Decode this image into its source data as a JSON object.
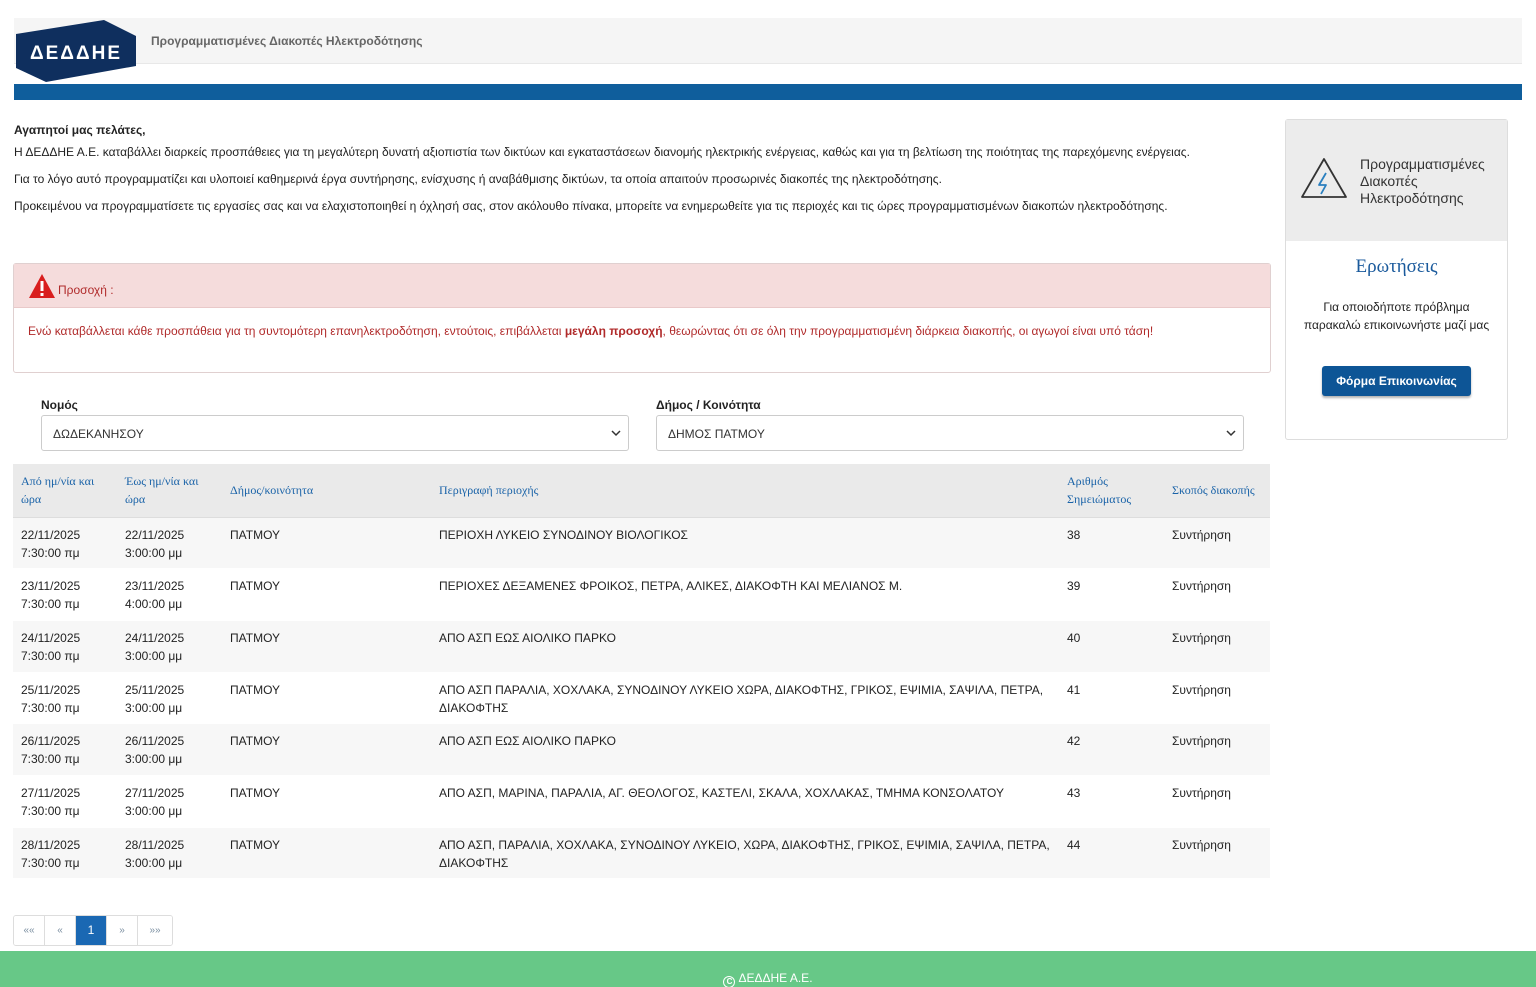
{
  "header": {
    "logo_text": "ΔΕΔΔΗΕ",
    "title": "Προγραμματισμένες Διακοπές Ηλεκτροδότησης"
  },
  "intro": {
    "greeting": "Αγαπητοί μας πελάτες,",
    "p1": "Η ΔΕΔΔΗΕ Α.Ε. καταβάλλει διαρκείς προσπάθειες για τη μεγαλύτερη δυνατή αξιοπιστία των δικτύων και εγκαταστάσεων διανομής ηλεκτρικής ενέργειας, καθώς και για τη βελτίωση της ποιότητας της παρεχόμενης ενέργειας.",
    "p2": "Για το λόγο αυτό προγραμματίζει και υλοποιεί καθημερινά έργα συντήρησης, ενίσχυσης ή αναβάθμισης δικτύων, τα οποία απαιτούν προσωρινές διακοπές της ηλεκτροδότησης.",
    "p3": "Προκειμένου να προγραμματίσετε τις εργασίες σας και να ελαχιστοποιηθεί η όχλησή σας, στον ακόλουθο πίνακα, μπορείτε να ενημερωθείτε για τις περιοχές και τις ώρες προγραμματισμένων διακοπών ηλεκτροδότησης."
  },
  "alert": {
    "title": "Προσοχή :",
    "text_before": "Ενώ καταβάλλεται κάθε προσπάθεια για τη συντομότερη επανηλεκτροδότηση, εντούτοις, επιβάλλεται ",
    "text_bold": "μεγάλη προσοχή",
    "text_after": ", θεωρώντας ότι σε όλη την προγραμματισμένη διάρκεια διακοπής, οι αγωγοί είναι υπό τάση!"
  },
  "filters": {
    "prefecture_label": "Νομός",
    "prefecture_value": "ΔΩΔΕΚΑΝΗΣΟΥ",
    "municipality_label": "Δήμος / Κοινότητα",
    "municipality_value": "ΔΗΜΟΣ ΠΑΤΜΟΥ"
  },
  "table": {
    "headers": {
      "from": "Από ημ/νία και ώρα",
      "to": "Έως ημ/νία και ώρα",
      "municipality": "Δήμος/κοινότητα",
      "area": "Περιγραφή περιοχής",
      "note_number": "Αριθμός Σημειώματος",
      "purpose": "Σκοπός διακοπής"
    },
    "rows": [
      {
        "from_date": "22/11/2025",
        "from_time": "7:30:00 πμ",
        "to_date": "22/11/2025",
        "to_time": "3:00:00 μμ",
        "municipality": "ΠΑΤΜΟΥ",
        "area": "ΠΕΡΙΟΧΗ ΛΥΚΕΙΟ ΣΥΝΟΔΙΝΟΥ ΒΙΟΛΟΓΙΚΟΣ",
        "note": "38",
        "purpose": "Συντήρηση"
      },
      {
        "from_date": "23/11/2025",
        "from_time": "7:30:00 πμ",
        "to_date": "23/11/2025",
        "to_time": "4:00:00 μμ",
        "municipality": "ΠΑΤΜΟΥ",
        "area": "ΠΕΡΙΟΧΕΣ ΔΕΞΑΜΕΝΕΣ ΦΡΟΙΚΟΣ, ΠΕΤΡΑ, ΑΛΙΚΕΣ, ΔΙΑΚΟΦΤΗ ΚΑΙ ΜΕΛΙΑΝΟΣ Μ.",
        "note": "39",
        "purpose": "Συντήρηση"
      },
      {
        "from_date": "24/11/2025",
        "from_time": "7:30:00 πμ",
        "to_date": "24/11/2025",
        "to_time": "3:00:00 μμ",
        "municipality": "ΠΑΤΜΟΥ",
        "area": "ΑΠΟ ΑΣΠ ΕΩΣ ΑΙΟΛΙΚΟ ΠΑΡΚΟ",
        "note": "40",
        "purpose": "Συντήρηση"
      },
      {
        "from_date": "25/11/2025",
        "from_time": "7:30:00 πμ",
        "to_date": "25/11/2025",
        "to_time": "3:00:00 μμ",
        "municipality": "ΠΑΤΜΟΥ",
        "area": "ΑΠΟ ΑΣΠ ΠΑΡΑΛΙΑ, ΧΟΧΛΑΚΑ, ΣΥΝΟΔΙΝΟΥ ΛΥΚΕΙΟ ΧΩΡΑ, ΔΙΑΚΟΦΤΗΣ, ΓΡΙΚΟΣ, ΕΨΙΜΙΑ, ΣΑΨΙΛΑ, ΠΕΤΡΑ, ΔΙΑΚΟΦΤΗΣ",
        "note": "41",
        "purpose": "Συντήρηση"
      },
      {
        "from_date": "26/11/2025",
        "from_time": "7:30:00 πμ",
        "to_date": "26/11/2025",
        "to_time": "3:00:00 μμ",
        "municipality": "ΠΑΤΜΟΥ",
        "area": "ΑΠΟ ΑΣΠ ΕΩΣ ΑΙΟΛΙΚΟ ΠΑΡΚΟ",
        "note": "42",
        "purpose": "Συντήρηση"
      },
      {
        "from_date": "27/11/2025",
        "from_time": "7:30:00 πμ",
        "to_date": "27/11/2025",
        "to_time": "3:00:00 μμ",
        "municipality": "ΠΑΤΜΟΥ",
        "area": "ΑΠΟ ΑΣΠ, ΜΑΡΙΝΑ, ΠΑΡΑΛΙΑ, ΑΓ. ΘΕΟΛΟΓΟΣ, ΚΑΣΤΕΛΙ, ΣΚΑΛΑ, ΧΟΧΛΑΚΑΣ, ΤΜΗΜΑ ΚΟΝΣΟΛΑΤΟΥ",
        "note": "43",
        "purpose": "Συντήρηση"
      },
      {
        "from_date": "28/11/2025",
        "from_time": "7:30:00 πμ",
        "to_date": "28/11/2025",
        "to_time": "3:00:00 μμ",
        "municipality": "ΠΑΤΜΟΥ",
        "area": "ΑΠΟ ΑΣΠ, ΠΑΡΑΛΙΑ, ΧΟΧΛΑΚΑ, ΣΥΝΟΔΙΝΟΥ ΛΥΚΕΙΟ, ΧΩΡΑ, ΔΙΑΚΟΦΤΗΣ, ΓΡΙΚΟΣ, ΕΨΙΜΙΑ, ΣΑΨΙΛΑ, ΠΕΤΡΑ, ΔΙΑΚΟΦΤΗΣ",
        "note": "44",
        "purpose": "Συντήρηση"
      }
    ]
  },
  "pagination": {
    "first": "««",
    "prev": "«",
    "current": "1",
    "next": "»",
    "last": "»»"
  },
  "sidebar": {
    "title": "Προγραμματισμένες Διακοπές Ηλεκτροδότησης",
    "questions_heading": "Ερωτήσεις",
    "text": "Για οποιοδήποτε πρόβλημα παρακαλώ επικοινωνήστε μαζί μας",
    "button": "Φόρμα Επικοινωνίας"
  },
  "footer": {
    "copyright_symbol": "C",
    "text": "ΔΕΔΔΗΕ Α.Ε."
  },
  "colors": {
    "brand_blue": "#0f5e9c",
    "footer_green": "#67c887",
    "alert_red": "#b02a2a"
  }
}
